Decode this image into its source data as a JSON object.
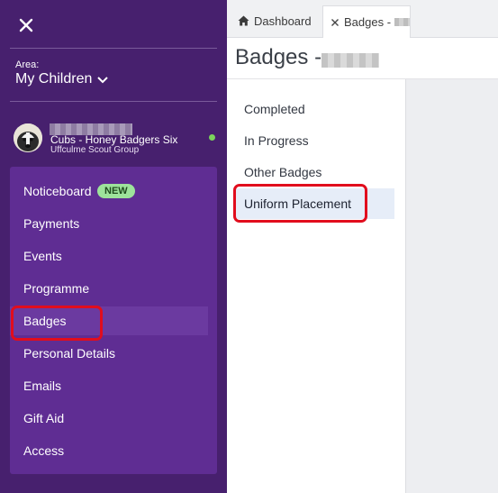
{
  "sidebar": {
    "area_label": "Area:",
    "area_value": "My Children",
    "profile": {
      "section": "Cubs - Honey Badgers Six",
      "group": "Uffculme Scout Group",
      "status_color": "#7bd35c"
    },
    "nav": [
      {
        "label": "Noticeboard",
        "badge": "NEW"
      },
      {
        "label": "Payments"
      },
      {
        "label": "Events"
      },
      {
        "label": "Programme"
      },
      {
        "label": "Badges"
      },
      {
        "label": "Personal Details"
      },
      {
        "label": "Emails"
      },
      {
        "label": "Gift Aid"
      },
      {
        "label": "Access"
      }
    ]
  },
  "tabs": [
    {
      "label": "Dashboard",
      "icon": "home-icon"
    },
    {
      "label": "Badges -",
      "icon": "close-icon"
    }
  ],
  "page": {
    "title": "Badges -"
  },
  "subnav": [
    {
      "label": "Completed"
    },
    {
      "label": "In Progress"
    },
    {
      "label": "Other Badges"
    },
    {
      "label": "Uniform Placement"
    }
  ],
  "colors": {
    "sidebar_bg": "#47206e",
    "nav_bg": "#5f2d93",
    "highlight": "#e10d1d",
    "new_badge": "#9de39b"
  }
}
